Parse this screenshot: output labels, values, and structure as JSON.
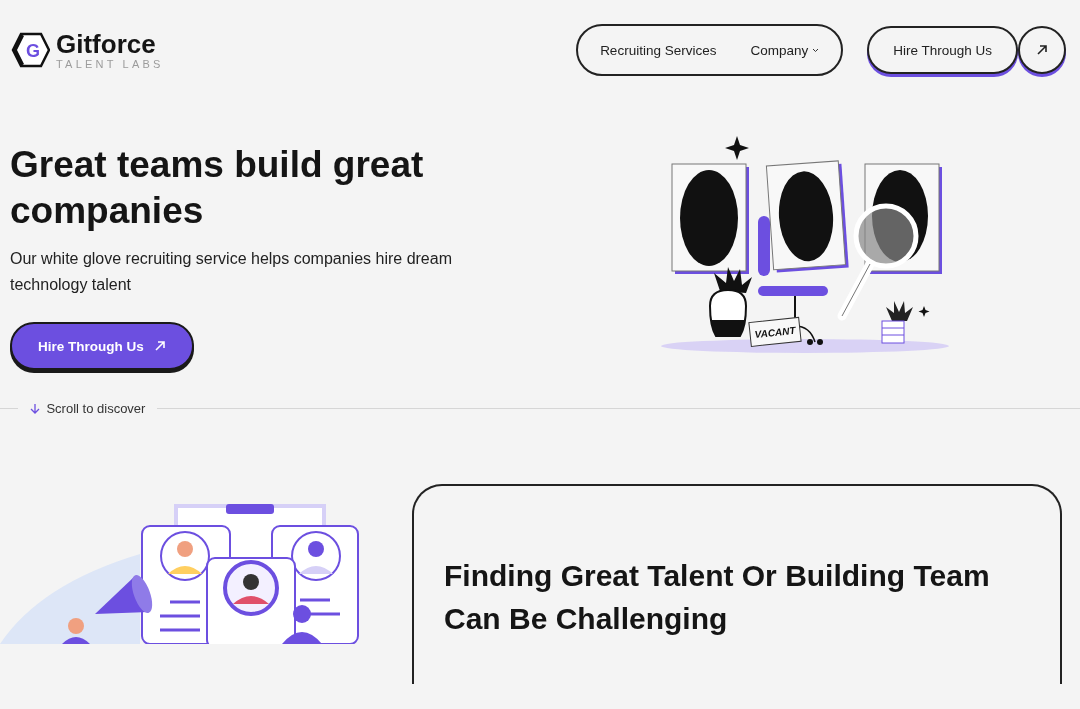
{
  "logo": {
    "mark": "G",
    "name": "Gitforce",
    "tagline": "TALENT LABS"
  },
  "nav": {
    "links": [
      {
        "label": "Recruiting Services",
        "kind": "link"
      },
      {
        "label": "Company",
        "kind": "dropdown"
      }
    ],
    "cta": "Hire Through Us"
  },
  "hero": {
    "title": "Great teams build great companies",
    "subtitle": "Our white glove recruiting service helps companies hire dream technology talent",
    "button": "Hire Through Us",
    "vacant_sign": "VACANT"
  },
  "scroll": {
    "label": "Scroll to discover"
  },
  "challenge": {
    "title": "Finding Great Talent Or Building Team Can Be Challenging"
  }
}
